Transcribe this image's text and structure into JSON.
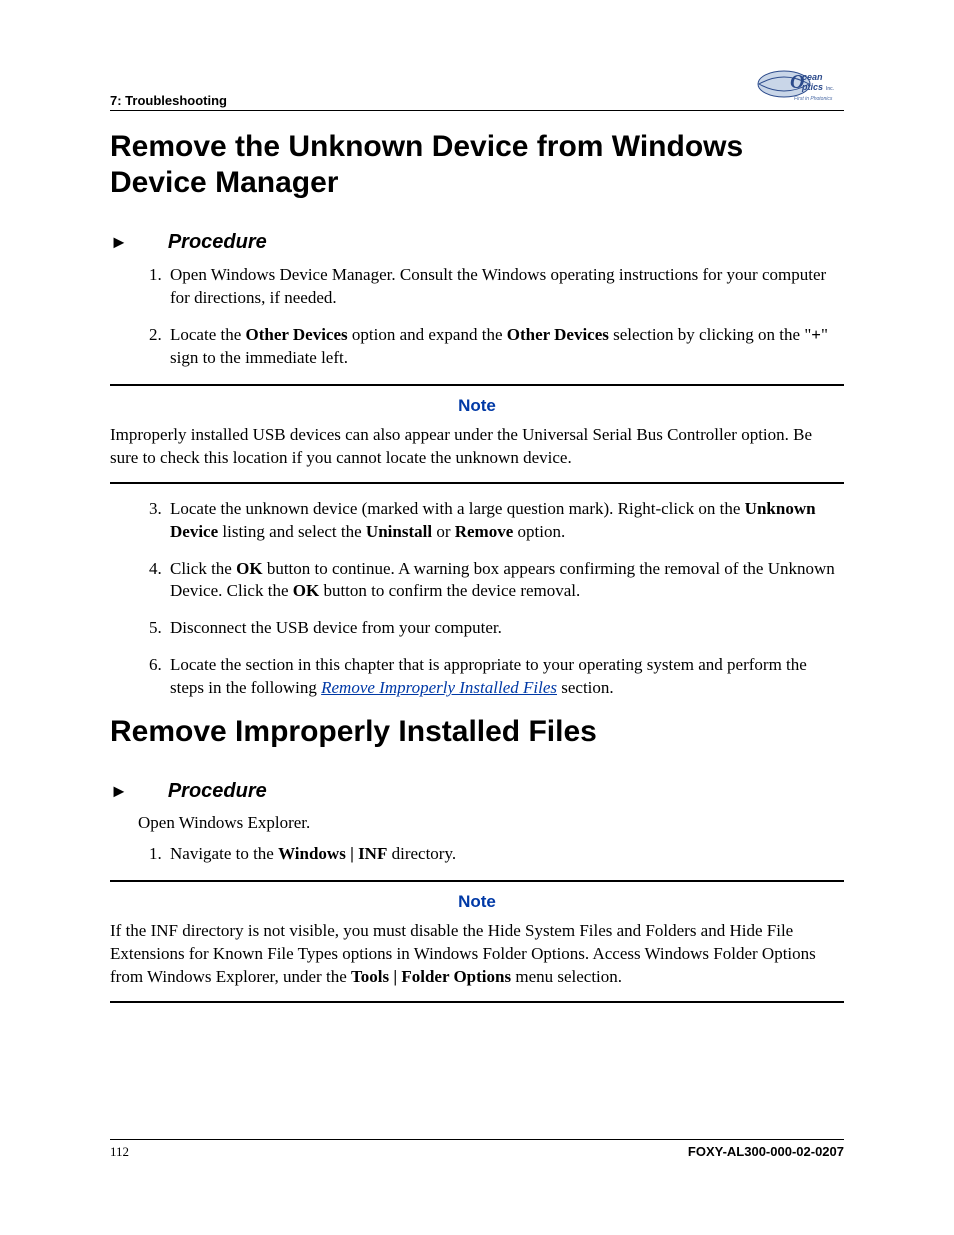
{
  "header": {
    "chapter_label": "7: Troubleshooting",
    "logo_alt": "Ocean Optics Inc. — First in Photonics"
  },
  "section1": {
    "title": "Remove the Unknown Device from Windows Device Manager",
    "procedure_label": "Procedure",
    "steps12": {
      "s1_a": "Open Windows Device Manager. Consult the Windows operating instructions for your computer for directions, if needed.",
      "s2_a": "Locate the ",
      "s2_b": "Other Devices",
      "s2_c": " option and expand the ",
      "s2_d": "Other Devices",
      "s2_e": " selection by clicking on the \"",
      "s2_f": "+",
      "s2_g": "\" sign to the immediate left."
    },
    "note_title": "Note",
    "note_body": "Improperly installed USB devices can also appear under the Universal Serial Bus Controller option. Be sure to check this location if you cannot locate the unknown device.",
    "steps36": {
      "s3_a": "Locate the unknown device (marked with a large question mark). Right-click on the ",
      "s3_b": "Unknown Device",
      "s3_c": " listing and select the ",
      "s3_d": "Uninstall",
      "s3_e": " or ",
      "s3_f": "Remove",
      "s3_g": " option.",
      "s4_a": "Click the ",
      "s4_b": "OK",
      "s4_c": " button to continue. A warning box appears confirming the removal of the Unknown Device. Click the ",
      "s4_d": "OK",
      "s4_e": " button to confirm the device removal.",
      "s5_a": "Disconnect the USB device from your computer.",
      "s6_a": "Locate the section in this chapter that is appropriate to your operating system and perform the steps in the following ",
      "s6_link": "Remove Improperly Installed Files",
      "s6_b": " section."
    }
  },
  "section2": {
    "title": "Remove Improperly Installed Files",
    "procedure_label": "Procedure",
    "intro": "Open Windows Explorer.",
    "step1_a": "Navigate to the ",
    "step1_b": "Windows | INF",
    "step1_c": " directory.",
    "note_title": "Note",
    "note_body_a": "If the INF directory is not visible, you must disable the Hide System Files and Folders and Hide File Extensions for Known File Types options in Windows Folder Options. Access Windows Folder Options from Windows Explorer, under the ",
    "note_body_b": "Tools | Folder Options",
    "note_body_c": " menu selection."
  },
  "footer": {
    "page_number": "112",
    "doc_code": "FOXY-AL300-000-02-0207"
  }
}
